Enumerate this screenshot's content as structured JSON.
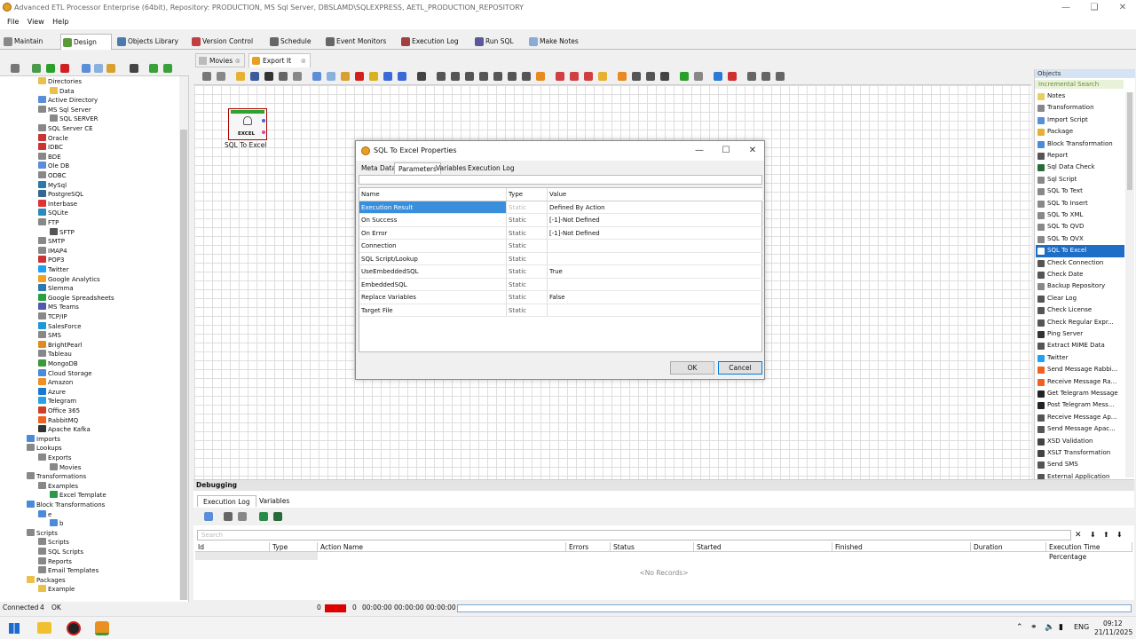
{
  "window": {
    "title": "Advanced ETL Processor Enterprise (64bit), Repository: PRODUCTION, MS Sql Server, DBSLAMD\\SQLEXPRESS, AETL_PRODUCTION_REPOSITORY"
  },
  "menu": [
    "File",
    "View",
    "Help"
  ],
  "main_tabs": [
    {
      "label": "Maintain",
      "icon": "wrench-icon"
    },
    {
      "label": "Design",
      "icon": "palette-icon"
    },
    {
      "label": "Objects Library",
      "icon": "library-icon"
    },
    {
      "label": "Version Control",
      "icon": "version-icon"
    },
    {
      "label": "Schedule",
      "icon": "clock-icon"
    },
    {
      "label": "Event Monitors",
      "icon": "monitor-icon"
    },
    {
      "label": "Execution Log",
      "icon": "log-icon"
    },
    {
      "label": "Run SQL",
      "icon": "sql-icon"
    },
    {
      "label": "Make Notes",
      "icon": "notes-icon"
    }
  ],
  "tree": [
    {
      "label": "Directories",
      "depth": 1,
      "color": "#e8c04a"
    },
    {
      "label": "Data",
      "depth": 2,
      "color": "#e8c04a"
    },
    {
      "label": "Active Directory",
      "depth": 1,
      "color": "#5a8ed8"
    },
    {
      "label": "MS Sql Server",
      "depth": 1,
      "color": "#888"
    },
    {
      "label": "SQL SERVER",
      "depth": 2,
      "color": "#888"
    },
    {
      "label": "SQL Server CE",
      "depth": 1,
      "color": "#888"
    },
    {
      "label": "Oracle",
      "depth": 1,
      "color": "#c33"
    },
    {
      "label": "IDBC",
      "depth": 1,
      "color": "#c33"
    },
    {
      "label": "BDE",
      "depth": 1,
      "color": "#888"
    },
    {
      "label": "Ole DB",
      "depth": 1,
      "color": "#5a8ed8"
    },
    {
      "label": "ODBC",
      "depth": 1,
      "color": "#888"
    },
    {
      "label": "MySql",
      "depth": 1,
      "color": "#2a7ab0"
    },
    {
      "label": "PostgreSQL",
      "depth": 1,
      "color": "#336791"
    },
    {
      "label": "Interbase",
      "depth": 1,
      "color": "#d33"
    },
    {
      "label": "SQLite",
      "depth": 1,
      "color": "#2a8ac0"
    },
    {
      "label": "FTP",
      "depth": 1,
      "color": "#888"
    },
    {
      "label": "SFTP",
      "depth": 2,
      "color": "#555"
    },
    {
      "label": "SMTP",
      "depth": 1,
      "color": "#888"
    },
    {
      "label": "IMAP4",
      "depth": 1,
      "color": "#888"
    },
    {
      "label": "POP3",
      "depth": 1,
      "color": "#c33"
    },
    {
      "label": "Twitter",
      "depth": 1,
      "color": "#1da1f2"
    },
    {
      "label": "Google Analytics",
      "depth": 1,
      "color": "#f4a020"
    },
    {
      "label": "Slemma",
      "depth": 1,
      "color": "#2a7ab0"
    },
    {
      "label": "Google Spreadsheets",
      "depth": 1,
      "color": "#2aa040"
    },
    {
      "label": "MS Teams",
      "depth": 1,
      "color": "#5058b0"
    },
    {
      "label": "TCP/IP",
      "depth": 1,
      "color": "#888"
    },
    {
      "label": "SalesForce",
      "depth": 1,
      "color": "#1a98d8"
    },
    {
      "label": "SMS",
      "depth": 1,
      "color": "#888"
    },
    {
      "label": "BrightPearl",
      "depth": 1,
      "color": "#e08a20"
    },
    {
      "label": "Tableau",
      "depth": 1,
      "color": "#888"
    },
    {
      "label": "MongoDB",
      "depth": 1,
      "color": "#3a9a3a"
    },
    {
      "label": "Cloud Storage",
      "depth": 1,
      "color": "#4a8ad8"
    },
    {
      "label": "Amazon",
      "depth": 1,
      "color": "#f09020"
    },
    {
      "label": "Azure",
      "depth": 1,
      "color": "#1a78d0"
    },
    {
      "label": "Telegram",
      "depth": 1,
      "color": "#2aa0e0"
    },
    {
      "label": "Office 365",
      "depth": 1,
      "color": "#d04020"
    },
    {
      "label": "RabbitMQ",
      "depth": 1,
      "color": "#f06020"
    },
    {
      "label": "Apache Kafka",
      "depth": 1,
      "color": "#333"
    },
    {
      "label": "Imports",
      "depth": 0,
      "color": "#4a8ad8"
    },
    {
      "label": "Lookups",
      "depth": 0,
      "color": "#888"
    },
    {
      "label": "Exports",
      "depth": 1,
      "color": "#888"
    },
    {
      "label": "Movies",
      "depth": 2,
      "color": "#888"
    },
    {
      "label": "Transformations",
      "depth": 0,
      "color": "#888"
    },
    {
      "label": "Examples",
      "depth": 1,
      "color": "#888"
    },
    {
      "label": "Excel Template",
      "depth": 2,
      "color": "#2a9a4a"
    },
    {
      "label": "Block Transformations",
      "depth": 0,
      "color": "#4a8ad8"
    },
    {
      "label": "e",
      "depth": 1,
      "color": "#4a8ad8"
    },
    {
      "label": "b",
      "depth": 2,
      "color": "#4a8ad8"
    },
    {
      "label": "Scripts",
      "depth": 0,
      "color": "#888"
    },
    {
      "label": "Scripts",
      "depth": 1,
      "color": "#888"
    },
    {
      "label": "SQL Scripts",
      "depth": 1,
      "color": "#888"
    },
    {
      "label": "Reports",
      "depth": 1,
      "color": "#888"
    },
    {
      "label": "Email Templates",
      "depth": 1,
      "color": "#888"
    },
    {
      "label": "Packages",
      "depth": 0,
      "color": "#e8c04a"
    },
    {
      "label": "Example",
      "depth": 1,
      "color": "#e8c04a"
    }
  ],
  "doc_tabs": [
    {
      "label": "Movies",
      "active": false
    },
    {
      "label": "Export It",
      "active": true
    }
  ],
  "canvas": {
    "node_label": "SQL To Excel",
    "node_caption": "EXCEL"
  },
  "objects_panel": {
    "title": "Objects",
    "search": "Incremental Search",
    "selected": "SQL To Excel",
    "items": [
      "Notes",
      "Transformation",
      "Import Script",
      "Package",
      "Block Transformation",
      "Report",
      "Sql Data Check",
      "Sql Script",
      "SQL To Text",
      "SQL To Insert",
      "SQL To XML",
      "SQL To QVD",
      "SQL To QVX",
      "SQL To Excel",
      "Check Connection",
      "Check Date",
      "Backup Repository",
      "Clear Log",
      "Check License",
      "Check Regular Expr...",
      "Ping Server",
      "Extract MIME Data",
      "Twitter",
      "Send Message Rabbi...",
      "Receive Message Ra...",
      "Get Telegram Message",
      "Post Telegram Mess...",
      "Receive Message Ap...",
      "Send Message Apac...",
      "XSD Validation",
      "XSLT Transformation",
      "Send SMS",
      "External Application"
    ]
  },
  "dialog": {
    "title": "SQL To Excel Properties",
    "tabs": [
      "Meta Data",
      "Parameters",
      "Variables",
      "Execution Log"
    ],
    "active_tab": "Parameters",
    "columns": [
      "Name",
      "Type",
      "Value"
    ],
    "rows": [
      {
        "name": "Execution Result",
        "type": "Static",
        "value": "Defined By Action"
      },
      {
        "name": "On Success",
        "type": "Static",
        "value": "[-1]-Not Defined"
      },
      {
        "name": "On Error",
        "type": "Static",
        "value": "[-1]-Not Defined"
      },
      {
        "name": "Connection",
        "type": "Static",
        "value": ""
      },
      {
        "name": "SQL Script/Lookup",
        "type": "Static",
        "value": ""
      },
      {
        "name": "UseEmbeddedSQL",
        "type": "Static",
        "value": "True"
      },
      {
        "name": "EmbeddedSQL",
        "type": "Static",
        "value": ""
      },
      {
        "name": "Replace Variables",
        "type": "Static",
        "value": "False"
      },
      {
        "name": "Target File",
        "type": "Static",
        "value": ""
      }
    ],
    "ok_label": "OK",
    "cancel_label": "Cancel"
  },
  "debugging": {
    "title": "Debugging",
    "tabs": [
      "Execution Log",
      "Variables"
    ],
    "search_placeholder": "Search",
    "columns": [
      "Id",
      "Type",
      "Action Name",
      "Errors",
      "Status",
      "Started",
      "Finished",
      "Duration",
      "Execution Time Percentage"
    ],
    "empty_text": "<No Records>"
  },
  "status": {
    "connected": "Connected",
    "count": "4",
    "ok": "OK",
    "errors": "0",
    "success": "0",
    "t1": "00:00:00",
    "t2": "00:00:00",
    "t3": "00:00:00"
  },
  "taskbar": {
    "lang": "ENG",
    "time": "09:12",
    "date": "21/11/2025"
  }
}
